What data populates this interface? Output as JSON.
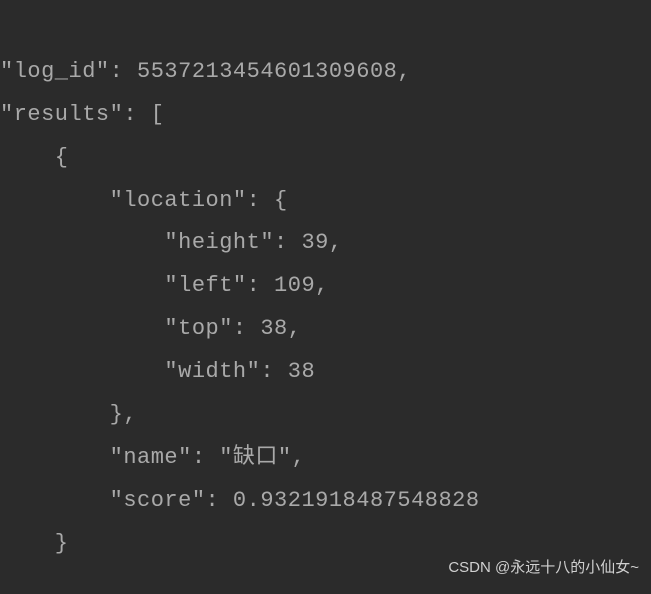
{
  "code": {
    "line1": "\"log_id\": 5537213454601309608,",
    "line2": "\"results\": [",
    "line3": "    {",
    "line4": "        \"location\": {",
    "line5": "            \"height\": 39,",
    "line6": "            \"left\": 109,",
    "line7": "            \"top\": 38,",
    "line8": "            \"width\": 38",
    "line9": "        },",
    "line10": "        \"name\": \"缺口\",",
    "line11": "        \"score\": 0.9321918487548828",
    "line12": "    }"
  },
  "watermark": "CSDN @永远十八的小仙女~"
}
